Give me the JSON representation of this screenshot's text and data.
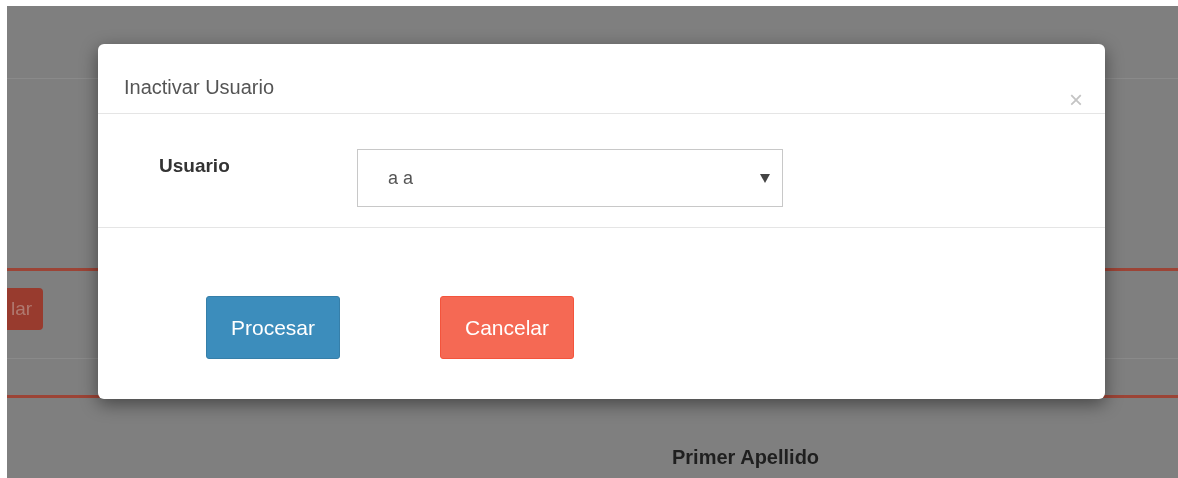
{
  "background": {
    "button": "lar",
    "column_header": "Primer Apellido"
  },
  "modal": {
    "title": "Inactivar Usuario",
    "close": "×",
    "fields": [
      {
        "label": "Usuario",
        "value": "a a"
      }
    ],
    "buttons": [
      {
        "label": "Procesar",
        "kind": "primary"
      },
      {
        "label": "Cancelar",
        "kind": "danger"
      }
    ]
  }
}
